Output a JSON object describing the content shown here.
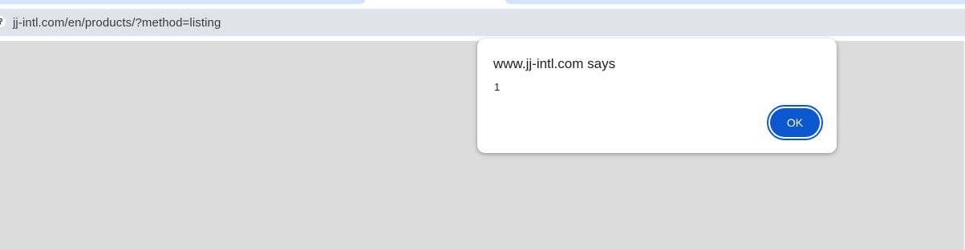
{
  "browser": {
    "address_bar": {
      "url": "jj-intl.com/en/products/?method=listing",
      "site_info_icon": "site-info-icon"
    }
  },
  "alert_dialog": {
    "title": "www.jj-intl.com says",
    "message": "1",
    "ok_label": "OK",
    "accent_color": "#0b57d0"
  },
  "colors": {
    "page_background": "#dcdcdc",
    "omnibox_background": "#e1e3ea",
    "tab_background": "#d3e3fd"
  }
}
